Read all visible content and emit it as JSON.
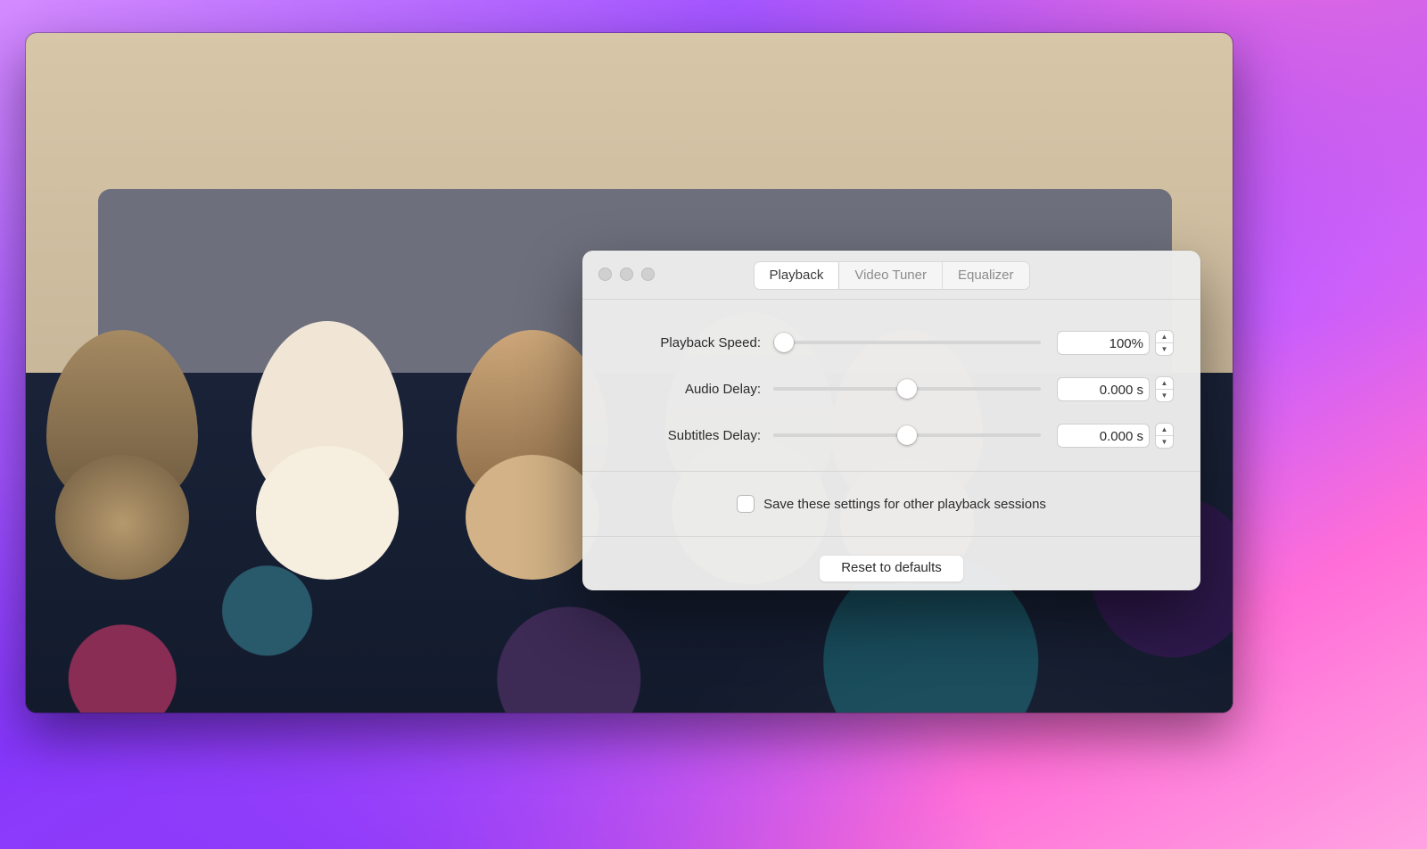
{
  "panel": {
    "tabs": [
      "Playback",
      "Video Tuner",
      "Equalizer"
    ],
    "active_tab_index": 0,
    "rows": {
      "speed": {
        "label": "Playback Speed:",
        "value": "100%",
        "thumb_pct": 4
      },
      "audio": {
        "label": "Audio Delay:",
        "value": "0.000 s",
        "thumb_pct": 50
      },
      "subs": {
        "label": "Subtitles Delay:",
        "value": "0.000 s",
        "thumb_pct": 50
      }
    },
    "save_label": "Save these settings for other playback sessions",
    "save_checked": false,
    "reset_label": "Reset to defaults"
  }
}
